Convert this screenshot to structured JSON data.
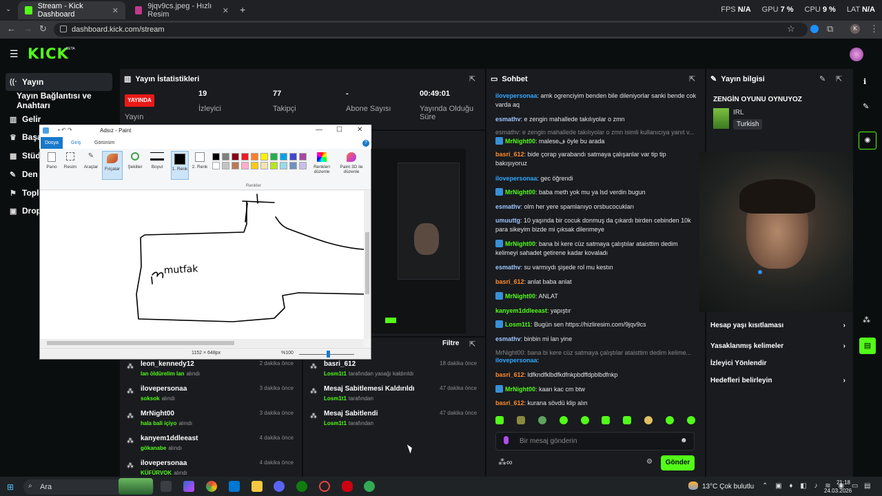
{
  "browser": {
    "tabs": [
      {
        "title": "Stream - Kick Dashboard",
        "active": true
      },
      {
        "title": "9jqv9cs.jpeg - Hızlı Resim",
        "active": false
      }
    ],
    "new_tab": "+",
    "url": "dashboard.kick.com/stream",
    "perf": {
      "fps_label": "FPS",
      "fps": "N/A",
      "gpu_label": "GPU",
      "gpu": "7 %",
      "cpu_label": "CPU",
      "cpu": "9 %",
      "lat_label": "LAT",
      "lat": "N/A"
    },
    "profile_initial": "K"
  },
  "kick": {
    "logo": "KICK",
    "beta": "BETA"
  },
  "sidebar": {
    "items": [
      {
        "label": "Yayın",
        "icon": "broadcast-icon"
      },
      {
        "label": "Yayın Bağlantısı ve Anahtarı",
        "icon": ""
      },
      {
        "label": "Gelir",
        "icon": "chart-icon"
      },
      {
        "label": "Başa",
        "icon": "trophy-icon"
      },
      {
        "label": "Stüd",
        "icon": "layout-icon"
      },
      {
        "label": "Den",
        "icon": "wrench-icon"
      },
      {
        "label": "Topl",
        "icon": "flag-icon"
      },
      {
        "label": "Drop",
        "icon": "grid-icon"
      }
    ]
  },
  "stats": {
    "title": "Yayın İstatistikleri",
    "live_badge": "YAYINDA",
    "live_label": "Yayın",
    "viewers": {
      "value": "19",
      "label": "İzleyici"
    },
    "followers": {
      "value": "77",
      "label": "Takipçi"
    },
    "subs": {
      "value": "-",
      "label": "Abone Sayısı"
    },
    "uptime": {
      "value": "00:49:01",
      "label": "Yayında Olduğu Süre"
    }
  },
  "paint": {
    "title": "Adsız - Paint",
    "menu": [
      "Dosya",
      "Giriş",
      "Görünüm"
    ],
    "tools": [
      "Pano",
      "Resim",
      "Araçlar",
      "Fırçalar",
      "Şekiller",
      "Boyut",
      "1. Renk",
      "2. Renk",
      "Renkleri düzenle",
      "Paint 3D ile düzenle"
    ],
    "colors_group": "Renkler",
    "status_size": "1152 × 648px",
    "zoom": "%100",
    "drawn_word": "mutfak",
    "palette": [
      "#000000",
      "#7f7f7f",
      "#880015",
      "#ed1c24",
      "#ff7f27",
      "#fff200",
      "#22b14c",
      "#00a2e8",
      "#3f48cc",
      "#a349a4",
      "#ffffff",
      "#c3c3c3",
      "#b97a57",
      "#ffaec9",
      "#ffc90e",
      "#efe4b0",
      "#b5e61d",
      "#99d9ea",
      "#7092be",
      "#c8bfe7"
    ]
  },
  "activity": {
    "filter_label": "Filtre",
    "left": [
      {
        "name": "leon_kennedy12",
        "sub": "lan öldürelim lan",
        "suffix": "alındı",
        "time": "2 dakika önce"
      },
      {
        "name": "ilovepersonaa",
        "sub": "soksok",
        "suffix": "alındı",
        "time": "3 dakika önce"
      },
      {
        "name": "MrNight00",
        "sub": "hala bali içiyo",
        "suffix": "alındı",
        "time": "3 dakika önce"
      },
      {
        "name": "kanyem1ddleeast",
        "sub": "gökanabe",
        "suffix": "alındı",
        "time": "4 dakika önce"
      },
      {
        "name": "ilovepersonaa",
        "sub": "KÜFÜRVOK",
        "suffix": "alındı",
        "time": "4 dakika önce"
      }
    ],
    "right": [
      {
        "name": "basri_612",
        "sub": "Losm1t1",
        "suffix": "tarafından yasağı kaldırıldı",
        "time": "18 dakika önce"
      },
      {
        "name": "Mesaj Sabitlemesi Kaldırıldı",
        "sub": "Losm1t1",
        "suffix": "tarafından",
        "time": "47 dakika önce"
      },
      {
        "name": "Mesaj Sabitlendi",
        "sub": "Losm1t1",
        "suffix": "tarafından",
        "time": "47 dakika önce"
      }
    ]
  },
  "chat": {
    "title": "Sohbet",
    "messages": [
      {
        "user": "ilovepersonaa",
        "color": "#2fa8ff",
        "text": ": amk ogrenciyim benden bile dileniyorlar sanki bende cok varda aq",
        "badge": false
      },
      {
        "user": "esmathv",
        "color": "#9ec5ff",
        "text": ": e zengin mahallede takılıyolar o zmn",
        "badge": false
      },
      {
        "user": "",
        "color": "#888888",
        "text": "esmathv: e zengin mahallede takılıyolar o zmn isimli kullanıcıya yanıt v...",
        "badge": false
      },
      {
        "user": "MrNight00",
        "color": "#53fc18",
        "text": ": maleseف öyle bu arada",
        "badge": true
      },
      {
        "user": "basri_612",
        "color": "#ff8c2e",
        "text": ": bide çorap yarabandı satmaya çalışanlar var tip tip bakışıyoruz",
        "badge": false
      },
      {
        "user": "ilovepersonaa",
        "color": "#2fa8ff",
        "text": ": gec öğrendi",
        "badge": false
      },
      {
        "user": "MrNight00",
        "color": "#53fc18",
        "text": ": baba meth yok mu ya lsd verdin bugun",
        "badge": true
      },
      {
        "user": "esmathv",
        "color": "#9ec5ff",
        "text": ": olm her yere spamlanıyo orsbucocukları",
        "badge": false
      },
      {
        "user": "umuuttg",
        "color": "#9ec5ff",
        "text": ": 10 yaşında bir cocuk donmuş da çıkardı birden cebinden 10k para sikeyim bizde mi çıksak dilenmeye",
        "badge": false
      },
      {
        "user": "MrNight00",
        "color": "#53fc18",
        "text": ": bana bi kere cüz satmaya çalıştılar ataisttim dedim kelimeyi sahadet getirene kadar kovaladı",
        "badge": true
      },
      {
        "user": "esmathv",
        "color": "#9ec5ff",
        "text": ": su varmıydı şişede rol mu kestın",
        "badge": false
      },
      {
        "user": "basri_612",
        "color": "#ff8c2e",
        "text": ": anlat baba anlat",
        "badge": false
      },
      {
        "user": "MrNight00",
        "color": "#53fc18",
        "text": ": ANLAT",
        "badge": true
      },
      {
        "user": "kanyem1ddleeast",
        "color": "#53fc18",
        "text": ": yapıştır",
        "badge": false
      },
      {
        "user": "Losm1t1",
        "color": "#53fc18",
        "text": ": Bugün sen https://hizliresim.com/9jqv9cs",
        "badge": true
      },
      {
        "user": "esmathv",
        "color": "#9ec5ff",
        "text": ": binbin mi lan yine",
        "badge": false
      },
      {
        "user": "",
        "color": "#888888",
        "text": "MrNight00: bana bi kere cüz satmaya çalıştılar ataisttim dedim kelime...",
        "badge": false
      },
      {
        "user": "ilovepersonaa",
        "color": "#2fa8ff",
        "text": ":",
        "badge": false
      },
      {
        "user": "basri_612",
        "color": "#ff8c2e",
        "text": ": ldfkndfklbdfkdfnkpbdffdpblbdfnkp",
        "badge": false
      },
      {
        "user": "MrNight00",
        "color": "#53fc18",
        "text": ": kaan kac cm btw",
        "badge": true
      },
      {
        "user": "basri_612",
        "color": "#ff8c2e",
        "text": ": kurana sövdü klip alın",
        "badge": false
      }
    ],
    "input_placeholder": "Bir mesaj gönderin",
    "send_label": "Gönder"
  },
  "info": {
    "title": "Yayın bilgisi",
    "stream_title": "ZENGİN OYUNU OYNUYOZ",
    "category": "IRL",
    "language": "Turkish",
    "links": [
      {
        "label": "Hesap yaşı kısıtlaması",
        "chevron": true
      },
      {
        "label": "Yasaklanmış kelimeler",
        "chevron": true
      },
      {
        "label": "İzleyici Yönlendir",
        "chevron": false
      },
      {
        "label": "Hedefleri belirleyin",
        "chevron": true
      }
    ]
  },
  "taskbar": {
    "search": "Ara",
    "weather": "13°C  Çok bulutlu",
    "time": "21:18",
    "date": "24.03.2026"
  },
  "colors": {
    "accent": "#53fc18",
    "live": "#e91916",
    "panel": "#191b1f",
    "bg": "#0b0e0f"
  }
}
